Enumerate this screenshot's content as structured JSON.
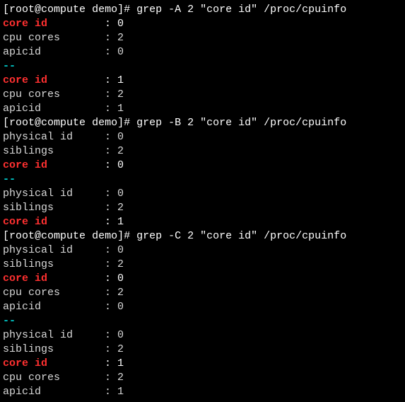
{
  "prompt": {
    "user": "root",
    "host": "compute",
    "dir": "demo",
    "symbol": "#"
  },
  "commands": {
    "a": "grep -A 2 \"core id\" /proc/cpuinfo",
    "b": "grep -B 2 \"core id\" /proc/cpuinfo",
    "c": "grep -C 2 \"core id\" /proc/cpuinfo"
  },
  "separator": "--",
  "blocks": {
    "A1": {
      "core_id": {
        "label": "core id",
        "value": "0",
        "hl": true
      },
      "cpu_cores": {
        "label": "cpu cores",
        "value": "2",
        "hl": false
      },
      "apicid": {
        "label": "apicid",
        "value": "0",
        "hl": false
      }
    },
    "A2": {
      "core_id": {
        "label": "core id",
        "value": "1",
        "hl": true
      },
      "cpu_cores": {
        "label": "cpu cores",
        "value": "2",
        "hl": false
      },
      "apicid": {
        "label": "apicid",
        "value": "1",
        "hl": false
      }
    },
    "B1": {
      "physical_id": {
        "label": "physical id",
        "value": "0",
        "hl": false
      },
      "siblings": {
        "label": "siblings",
        "value": "2",
        "hl": false
      },
      "core_id": {
        "label": "core id",
        "value": "0",
        "hl": true
      }
    },
    "B2": {
      "physical_id": {
        "label": "physical id",
        "value": "0",
        "hl": false
      },
      "siblings": {
        "label": "siblings",
        "value": "2",
        "hl": false
      },
      "core_id": {
        "label": "core id",
        "value": "1",
        "hl": true
      }
    },
    "C1": {
      "physical_id": {
        "label": "physical id",
        "value": "0",
        "hl": false
      },
      "siblings": {
        "label": "siblings",
        "value": "2",
        "hl": false
      },
      "core_id": {
        "label": "core id",
        "value": "0",
        "hl": true
      },
      "cpu_cores": {
        "label": "cpu cores",
        "value": "2",
        "hl": false
      },
      "apicid": {
        "label": "apicid",
        "value": "0",
        "hl": false
      }
    },
    "C2": {
      "physical_id": {
        "label": "physical id",
        "value": "0",
        "hl": false
      },
      "siblings": {
        "label": "siblings",
        "value": "2",
        "hl": false
      },
      "core_id": {
        "label": "core id",
        "value": "1",
        "hl": true
      },
      "cpu_cores": {
        "label": "cpu cores",
        "value": "2",
        "hl": false
      },
      "apicid": {
        "label": "apicid",
        "value": "1",
        "hl": false
      }
    }
  }
}
